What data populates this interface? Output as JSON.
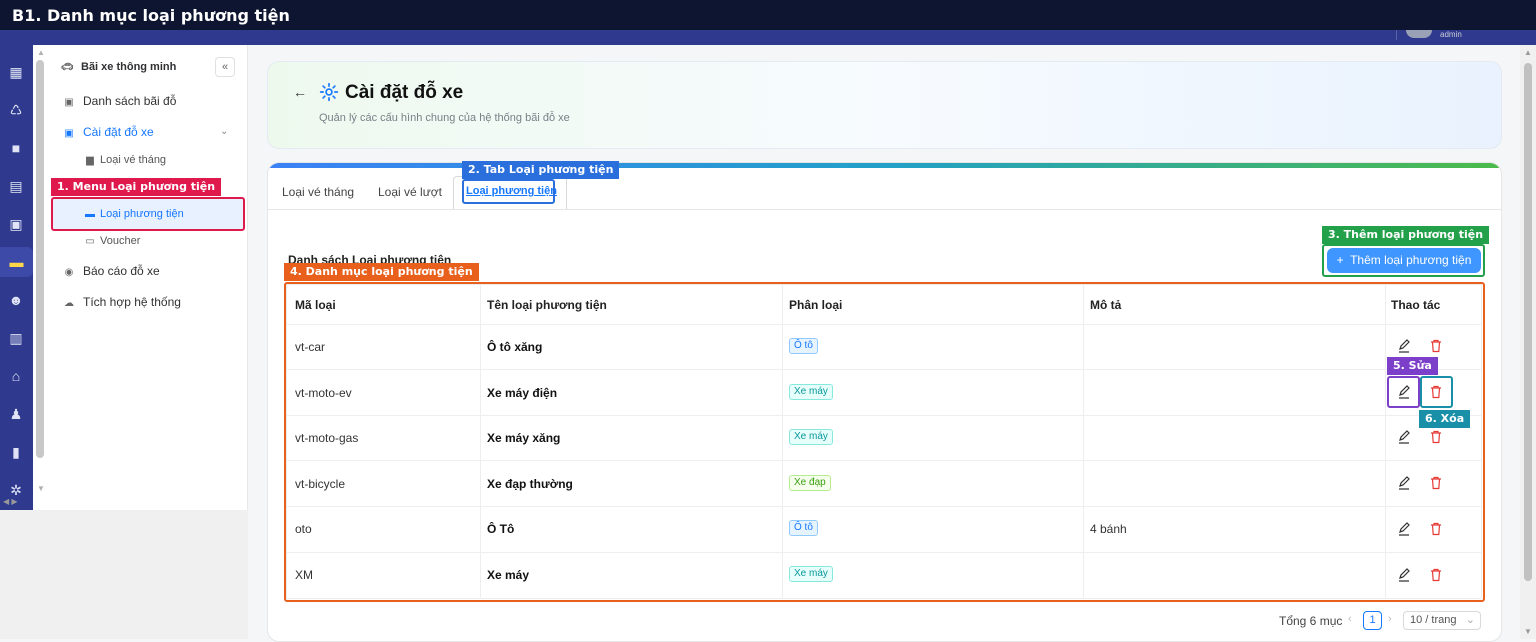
{
  "window_title": "B1. Danh mục loại phương tiện",
  "topbar": {
    "user": "admin"
  },
  "sidebar": {
    "collapse_label": "«",
    "items": [
      {
        "label": "Bãi xe thông minh",
        "icon": "car-icon"
      },
      {
        "label": "Danh sách bãi đỗ",
        "icon": "parking-icon"
      },
      {
        "label": "Cài đặt đỗ xe",
        "icon": "parking-icon"
      },
      {
        "label": "Loại vé tháng",
        "icon": "calendar-icon"
      },
      {
        "label": "Loại phương tiện",
        "icon": "car-icon"
      },
      {
        "label": "Voucher",
        "icon": "ticket-icon"
      },
      {
        "label": "Báo cáo đỗ xe",
        "icon": "report-icon"
      },
      {
        "label": "Tích hợp hệ thống",
        "icon": "cloud-icon"
      }
    ]
  },
  "header": {
    "title": "Cài đặt đỗ xe",
    "subtitle": "Quản lý các cấu hình chung của hệ thống bãi đỗ xe"
  },
  "tabs": [
    {
      "label": "Loại vé tháng"
    },
    {
      "label": "Loại vé lượt"
    },
    {
      "label": "Loại phương tiện"
    }
  ],
  "list_title": "Danh sách Loại phương tiện",
  "add_button": "Thêm loại phương tiện",
  "table": {
    "columns": [
      "Mã loại",
      "Tên loại phương tiện",
      "Phân loại",
      "Mô tả",
      "Thao tác"
    ],
    "rows": [
      {
        "code": "vt-car",
        "name": "Ô tô xăng",
        "type": "Ô tô",
        "desc": ""
      },
      {
        "code": "vt-moto-ev",
        "name": "Xe máy điện",
        "type": "Xe máy",
        "desc": ""
      },
      {
        "code": "vt-moto-gas",
        "name": "Xe máy xăng",
        "type": "Xe máy",
        "desc": ""
      },
      {
        "code": "vt-bicycle",
        "name": "Xe đạp thường",
        "type": "Xe đạp",
        "desc": ""
      },
      {
        "code": "oto",
        "name": "Ô Tô",
        "type": "Ô tô",
        "desc": "4 bánh"
      },
      {
        "code": "XM",
        "name": "Xe máy",
        "type": "Xe máy",
        "desc": ""
      }
    ]
  },
  "pagination": {
    "total": "Tổng 6 mục",
    "current_page": "1",
    "page_size": "10 / trang"
  },
  "annotations": [
    {
      "text": "1. Menu Loại phương tiện",
      "color": "#e0194d"
    },
    {
      "text": "2. Tab Loại phương tiện",
      "color": "#2a6fdb"
    },
    {
      "text": "3. Thêm loại phương tiện",
      "color": "#22a04a"
    },
    {
      "text": "4. Danh mục loại phương tiện",
      "color": "#e8601c"
    },
    {
      "text": "5. Sửa",
      "color": "#7b3fc9"
    },
    {
      "text": "6. Xóa",
      "color": "#1a8fa8"
    }
  ]
}
